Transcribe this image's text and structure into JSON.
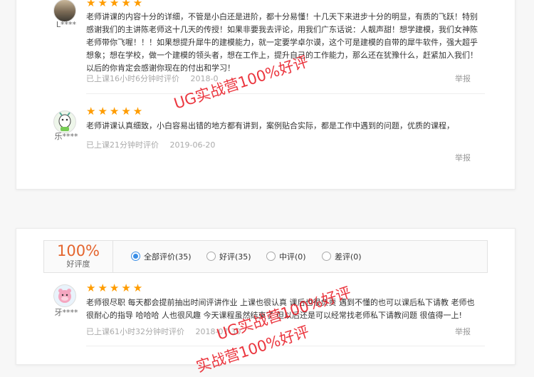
{
  "reviews_top": [
    {
      "user": "L****",
      "stars": "★★★★★",
      "text": "老师讲课的内容十分的详细，不管是小白还是进阶，都十分易懂！十几天下来进步十分的明显，有质的飞跃！特别感谢我们的主讲陈老师这十几天的传授！如果非要我去评论，用我们广东话说：人靓声甜！想学建模，我们女神陈老师带你飞喔！！！如果想提升犀牛的建模能力，就一定要学卓尔谟，这个可是建模的自带的犀牛软件，强大超乎想象；想在学校，做一个建模的领头者，想在工作上，提升自己的工作能力，那么还在犹豫什么，赶紧加入我们！以后的你肯定会感谢你现在的付出和学习！",
      "meta1": "已上课16小时6分钟时评价",
      "meta2": "2018-0",
      "report": "举报"
    },
    {
      "user": "乐****",
      "stars": "★★★★★",
      "text": "老师讲课认真细致，小白容易出错的地方都有讲到，案例贴合实际，都是工作中遇到的问题，优质的课程，",
      "meta1": "已上课21分钟时评价",
      "meta2": "2019-06-20",
      "report": "举报"
    }
  ],
  "rating": {
    "percent": "100%",
    "label": "好评度",
    "options": [
      {
        "label": "全部评价(35)",
        "selected": true
      },
      {
        "label": "好评(35)",
        "selected": false
      },
      {
        "label": "中评(0)",
        "selected": false
      },
      {
        "label": "差评(0)",
        "selected": false
      }
    ]
  },
  "reviews_bottom": [
    {
      "user": "牙****",
      "stars": "★★★★★",
      "text": "老师很尽职 每天都会提前抽出时间评讲作业 上课也很认真 课后也很负责 遇到不懂的也可以课后私下请教 老师也很耐心的指导 哈哈哈 人也很风趣 今天课程虽然结束了 但以后还是可以经常找老师私下请教问题 很值得一上!",
      "meta1": "已上课61小时32分钟时评价",
      "meta2": "2018-07-30",
      "report": "举报"
    }
  ],
  "watermarks": [
    "UG实战营100%好评",
    "UG实战营100%好评",
    "实战营100%好评"
  ],
  "colors": {
    "star": "#ff9c00",
    "accent": "#e4652e",
    "radio": "#3a8ee6",
    "watermark": "#e8141e"
  }
}
